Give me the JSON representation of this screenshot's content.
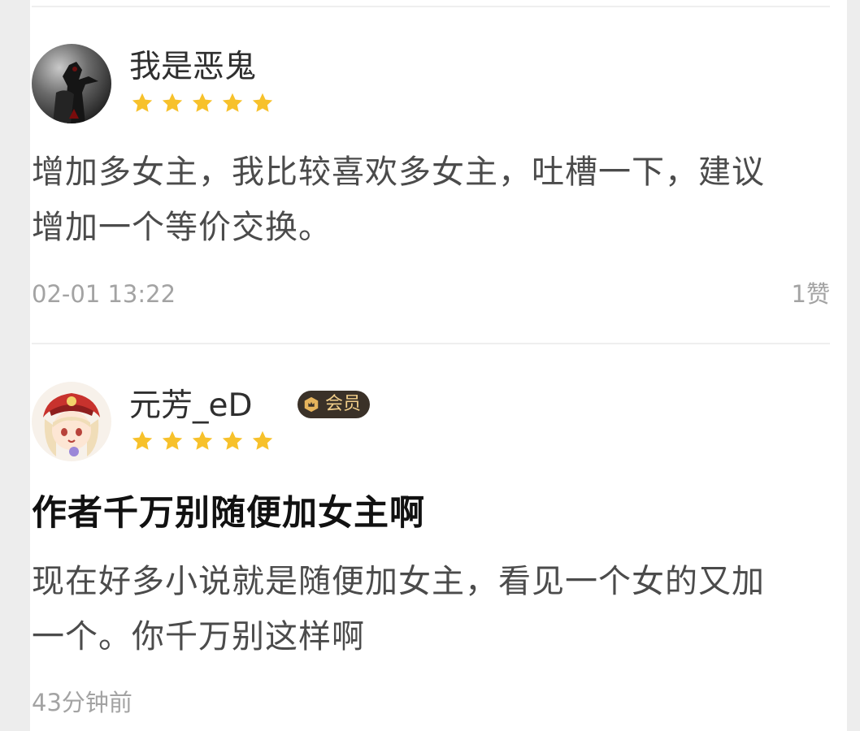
{
  "reviews": [
    {
      "username": "我是恶鬼",
      "rating": 5,
      "avatar_icon": "dark-knight-avatar",
      "content": "增加多女主，我比较喜欢多女主，吐槽一下，建议增加一个等价交换。",
      "timestamp": "02-01 13:22",
      "likes": "1赞"
    },
    {
      "username": "元芳_eD",
      "rating": 5,
      "avatar_icon": "anime-girl-avatar",
      "vip_badge": "会员",
      "title": "作者千万别随便加女主啊",
      "content": "现在好多小说就是随便加女主，看见一个女的又加一个。你千万别这样啊",
      "timestamp": "43分钟前"
    }
  ],
  "colors": {
    "star": "#f7c12b",
    "badge_bg": "#3a3128",
    "badge_text": "#f2cf8a",
    "muted_text": "#a3a3a3"
  }
}
